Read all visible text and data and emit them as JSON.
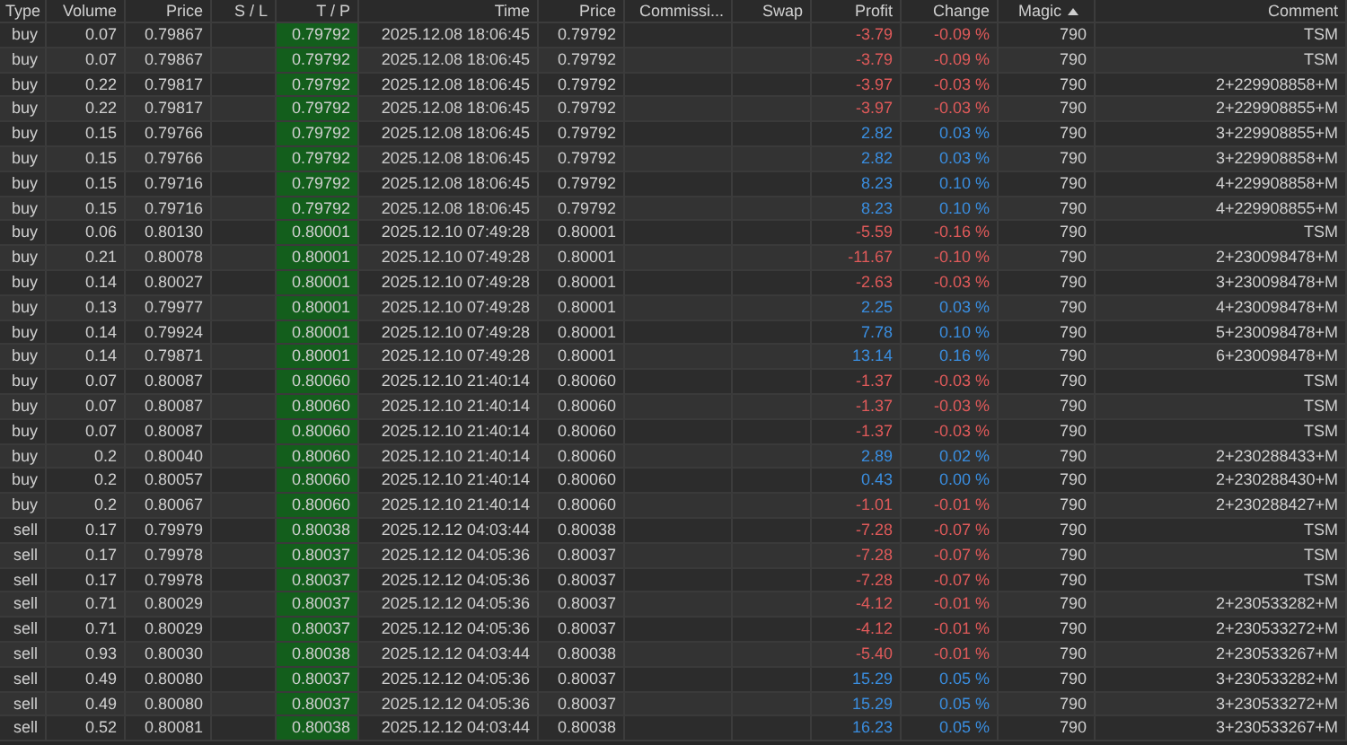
{
  "columns": [
    {
      "label": "Type",
      "sorted": false
    },
    {
      "label": "Volume",
      "sorted": false
    },
    {
      "label": "Price",
      "sorted": false
    },
    {
      "label": "S / L",
      "sorted": false
    },
    {
      "label": "T / P",
      "sorted": false
    },
    {
      "label": "Time",
      "sorted": false
    },
    {
      "label": "Price",
      "sorted": false
    },
    {
      "label": "Commissi...",
      "sorted": false
    },
    {
      "label": "Swap",
      "sorted": false
    },
    {
      "label": "Profit",
      "sorted": false
    },
    {
      "label": "Change",
      "sorted": false
    },
    {
      "label": "Magic",
      "sorted": true
    },
    {
      "label": "Comment",
      "sorted": false
    }
  ],
  "rows": [
    {
      "type": "buy",
      "volume": "0.07",
      "open_price": "0.79867",
      "tp": "0.79792",
      "time": "2025.12.08 18:06:45",
      "price": "0.79792",
      "profit": "-3.79",
      "change": "-0.09 %",
      "magic": "790",
      "comment": "TSM",
      "color": "#e05a5a"
    },
    {
      "type": "buy",
      "volume": "0.07",
      "open_price": "0.79867",
      "tp": "0.79792",
      "time": "2025.12.08 18:06:45",
      "price": "0.79792",
      "profit": "-3.79",
      "change": "-0.09 %",
      "magic": "790",
      "comment": "TSM",
      "color": "#e05a5a"
    },
    {
      "type": "buy",
      "volume": "0.22",
      "open_price": "0.79817",
      "tp": "0.79792",
      "time": "2025.12.08 18:06:45",
      "price": "0.79792",
      "profit": "-3.97",
      "change": "-0.03 %",
      "magic": "790",
      "comment": "2+229908858+M",
      "color": "#e05a5a"
    },
    {
      "type": "buy",
      "volume": "0.22",
      "open_price": "0.79817",
      "tp": "0.79792",
      "time": "2025.12.08 18:06:45",
      "price": "0.79792",
      "profit": "-3.97",
      "change": "-0.03 %",
      "magic": "790",
      "comment": "2+229908855+M",
      "color": "#e05a5a"
    },
    {
      "type": "buy",
      "volume": "0.15",
      "open_price": "0.79766",
      "tp": "0.79792",
      "time": "2025.12.08 18:06:45",
      "price": "0.79792",
      "profit": "2.82",
      "change": "0.03 %",
      "magic": "790",
      "comment": "3+229908855+M",
      "color": "#3a8ee0"
    },
    {
      "type": "buy",
      "volume": "0.15",
      "open_price": "0.79766",
      "tp": "0.79792",
      "time": "2025.12.08 18:06:45",
      "price": "0.79792",
      "profit": "2.82",
      "change": "0.03 %",
      "magic": "790",
      "comment": "3+229908858+M",
      "color": "#3a8ee0"
    },
    {
      "type": "buy",
      "volume": "0.15",
      "open_price": "0.79716",
      "tp": "0.79792",
      "time": "2025.12.08 18:06:45",
      "price": "0.79792",
      "profit": "8.23",
      "change": "0.10 %",
      "magic": "790",
      "comment": "4+229908858+M",
      "color": "#3a8ee0"
    },
    {
      "type": "buy",
      "volume": "0.15",
      "open_price": "0.79716",
      "tp": "0.79792",
      "time": "2025.12.08 18:06:45",
      "price": "0.79792",
      "profit": "8.23",
      "change": "0.10 %",
      "magic": "790",
      "comment": "4+229908855+M",
      "color": "#3a8ee0"
    },
    {
      "type": "buy",
      "volume": "0.06",
      "open_price": "0.80130",
      "tp": "0.80001",
      "time": "2025.12.10 07:49:28",
      "price": "0.80001",
      "profit": "-5.59",
      "change": "-0.16 %",
      "magic": "790",
      "comment": "TSM",
      "color": "#e05a5a"
    },
    {
      "type": "buy",
      "volume": "0.21",
      "open_price": "0.80078",
      "tp": "0.80001",
      "time": "2025.12.10 07:49:28",
      "price": "0.80001",
      "profit": "-11.67",
      "change": "-0.10 %",
      "magic": "790",
      "comment": "2+230098478+M",
      "color": "#e05a5a"
    },
    {
      "type": "buy",
      "volume": "0.14",
      "open_price": "0.80027",
      "tp": "0.80001",
      "time": "2025.12.10 07:49:28",
      "price": "0.80001",
      "profit": "-2.63",
      "change": "-0.03 %",
      "magic": "790",
      "comment": "3+230098478+M",
      "color": "#e05a5a"
    },
    {
      "type": "buy",
      "volume": "0.13",
      "open_price": "0.79977",
      "tp": "0.80001",
      "time": "2025.12.10 07:49:28",
      "price": "0.80001",
      "profit": "2.25",
      "change": "0.03 %",
      "magic": "790",
      "comment": "4+230098478+M",
      "color": "#3a8ee0"
    },
    {
      "type": "buy",
      "volume": "0.14",
      "open_price": "0.79924",
      "tp": "0.80001",
      "time": "2025.12.10 07:49:28",
      "price": "0.80001",
      "profit": "7.78",
      "change": "0.10 %",
      "magic": "790",
      "comment": "5+230098478+M",
      "color": "#3a8ee0"
    },
    {
      "type": "buy",
      "volume": "0.14",
      "open_price": "0.79871",
      "tp": "0.80001",
      "time": "2025.12.10 07:49:28",
      "price": "0.80001",
      "profit": "13.14",
      "change": "0.16 %",
      "magic": "790",
      "comment": "6+230098478+M",
      "color": "#3a8ee0"
    },
    {
      "type": "buy",
      "volume": "0.07",
      "open_price": "0.80087",
      "tp": "0.80060",
      "time": "2025.12.10 21:40:14",
      "price": "0.80060",
      "profit": "-1.37",
      "change": "-0.03 %",
      "magic": "790",
      "comment": "TSM",
      "color": "#e05a5a"
    },
    {
      "type": "buy",
      "volume": "0.07",
      "open_price": "0.80087",
      "tp": "0.80060",
      "time": "2025.12.10 21:40:14",
      "price": "0.80060",
      "profit": "-1.37",
      "change": "-0.03 %",
      "magic": "790",
      "comment": "TSM",
      "color": "#e05a5a"
    },
    {
      "type": "buy",
      "volume": "0.07",
      "open_price": "0.80087",
      "tp": "0.80060",
      "time": "2025.12.10 21:40:14",
      "price": "0.80060",
      "profit": "-1.37",
      "change": "-0.03 %",
      "magic": "790",
      "comment": "TSM",
      "color": "#e05a5a"
    },
    {
      "type": "buy",
      "volume": "0.2",
      "open_price": "0.80040",
      "tp": "0.80060",
      "time": "2025.12.10 21:40:14",
      "price": "0.80060",
      "profit": "2.89",
      "change": "0.02 %",
      "magic": "790",
      "comment": "2+230288433+M",
      "color": "#3a8ee0"
    },
    {
      "type": "buy",
      "volume": "0.2",
      "open_price": "0.80057",
      "tp": "0.80060",
      "time": "2025.12.10 21:40:14",
      "price": "0.80060",
      "profit": "0.43",
      "change": "0.00 %",
      "magic": "790",
      "comment": "2+230288430+M",
      "color": "#3a8ee0"
    },
    {
      "type": "buy",
      "volume": "0.2",
      "open_price": "0.80067",
      "tp": "0.80060",
      "time": "2025.12.10 21:40:14",
      "price": "0.80060",
      "profit": "-1.01",
      "change": "-0.01 %",
      "magic": "790",
      "comment": "2+230288427+M",
      "color": "#e05a5a"
    },
    {
      "type": "sell",
      "volume": "0.17",
      "open_price": "0.79979",
      "tp": "0.80038",
      "time": "2025.12.12 04:03:44",
      "price": "0.80038",
      "profit": "-7.28",
      "change": "-0.07 %",
      "magic": "790",
      "comment": "TSM",
      "color": "#e05a5a"
    },
    {
      "type": "sell",
      "volume": "0.17",
      "open_price": "0.79978",
      "tp": "0.80037",
      "time": "2025.12.12 04:05:36",
      "price": "0.80037",
      "profit": "-7.28",
      "change": "-0.07 %",
      "magic": "790",
      "comment": "TSM",
      "color": "#e05a5a"
    },
    {
      "type": "sell",
      "volume": "0.17",
      "open_price": "0.79978",
      "tp": "0.80037",
      "time": "2025.12.12 04:05:36",
      "price": "0.80037",
      "profit": "-7.28",
      "change": "-0.07 %",
      "magic": "790",
      "comment": "TSM",
      "color": "#e05a5a"
    },
    {
      "type": "sell",
      "volume": "0.71",
      "open_price": "0.80029",
      "tp": "0.80037",
      "time": "2025.12.12 04:05:36",
      "price": "0.80037",
      "profit": "-4.12",
      "change": "-0.01 %",
      "magic": "790",
      "comment": "2+230533282+M",
      "color": "#e05a5a"
    },
    {
      "type": "sell",
      "volume": "0.71",
      "open_price": "0.80029",
      "tp": "0.80037",
      "time": "2025.12.12 04:05:36",
      "price": "0.80037",
      "profit": "-4.12",
      "change": "-0.01 %",
      "magic": "790",
      "comment": "2+230533272+M",
      "color": "#e05a5a"
    },
    {
      "type": "sell",
      "volume": "0.93",
      "open_price": "0.80030",
      "tp": "0.80038",
      "time": "2025.12.12 04:03:44",
      "price": "0.80038",
      "profit": "-5.40",
      "change": "-0.01 %",
      "magic": "790",
      "comment": "2+230533267+M",
      "color": "#e05a5a"
    },
    {
      "type": "sell",
      "volume": "0.49",
      "open_price": "0.80080",
      "tp": "0.80037",
      "time": "2025.12.12 04:05:36",
      "price": "0.80037",
      "profit": "15.29",
      "change": "0.05 %",
      "magic": "790",
      "comment": "3+230533282+M",
      "color": "#3a8ee0"
    },
    {
      "type": "sell",
      "volume": "0.49",
      "open_price": "0.80080",
      "tp": "0.80037",
      "time": "2025.12.12 04:05:36",
      "price": "0.80037",
      "profit": "15.29",
      "change": "0.05 %",
      "magic": "790",
      "comment": "3+230533272+M",
      "color": "#3a8ee0"
    },
    {
      "type": "sell",
      "volume": "0.52",
      "open_price": "0.80081",
      "tp": "0.80038",
      "time": "2025.12.12 04:03:44",
      "price": "0.80038",
      "profit": "16.23",
      "change": "0.05 %",
      "magic": "790",
      "comment": "3+230533267+M",
      "color": "#3a8ee0"
    }
  ]
}
